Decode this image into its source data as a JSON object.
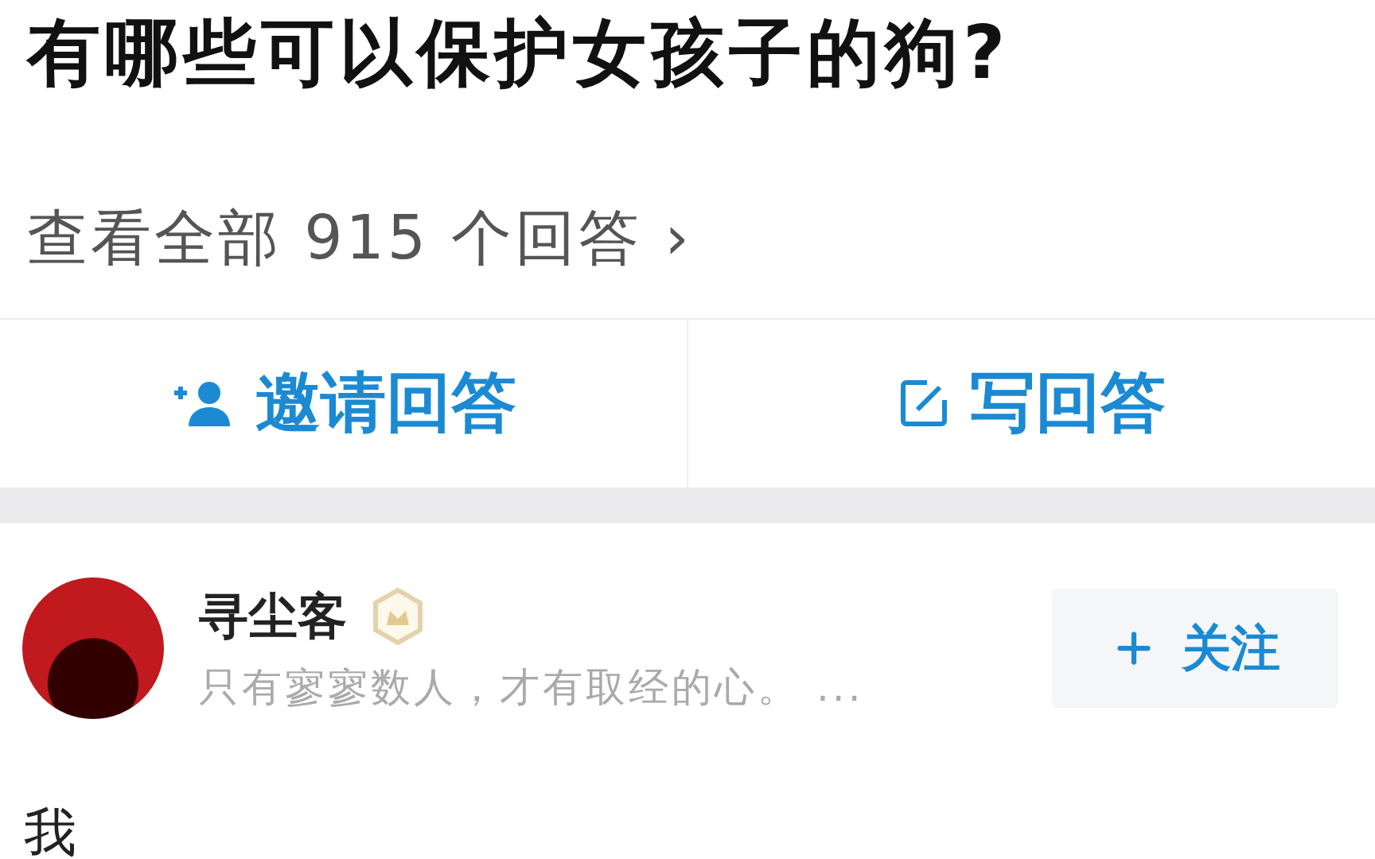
{
  "question": {
    "title": "有哪些可以保护女孩子的狗?",
    "all_answers_link": "查看全部 915 个回答 ›"
  },
  "actions": [
    {
      "kind": "invite",
      "label": "邀请回答"
    },
    {
      "kind": "write",
      "label": "写回答"
    }
  ],
  "answer": {
    "author": {
      "name": "寻尘客",
      "bio": "只有寥寥数人，才有取经的心。 ...",
      "follow_label": "关注"
    },
    "body": "我"
  }
}
